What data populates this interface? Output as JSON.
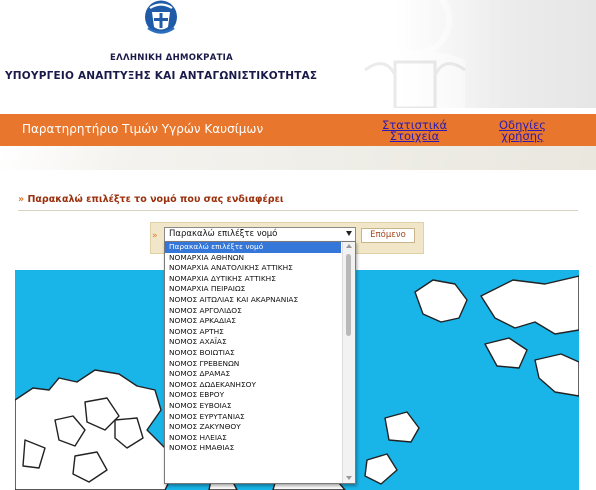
{
  "header": {
    "government": "ΕΛΛΗΝΙΚΗ ΔΗΜΟΚΡΑΤΙΑ",
    "ministry": "ΥΠΟΥΡΓΕΙΟ ΑΝΑΠΤΥΞΗΣ ΚΑΙ ΑΝΤΑΓΩΝΙΣΤΙΚΟΤΗΤΑΣ",
    "emblem_icon": "hellenic-republic-emblem"
  },
  "nav": {
    "main_title": "Παρατηρητήριο Τιμών Υγρών Καυσίμων",
    "statistics_line1": "Στατιστικά",
    "statistics_line2": "Στοιχεία",
    "help_line1": "Οδηγίες",
    "help_line2": "χρήσης"
  },
  "prompt": {
    "bullet": "»",
    "text": "Παρακαλώ επιλέξτε το νομό που σας ενδιαφέρει"
  },
  "selector": {
    "bullet": "»",
    "selected_value": "Παρακαλώ επιλέξτε νομό",
    "next_button": "Επόμενο",
    "options": [
      "Παρακαλώ επιλέξτε νομό",
      "ΝΟΜΑΡΧΙΑ ΑΘΗΝΩΝ",
      "ΝΟΜΑΡΧΙΑ ΑΝΑΤΟΛΙΚΗΣ ΑΤΤΙΚΗΣ",
      "ΝΟΜΑΡΧΙΑ ΔΥΤΙΚΗΣ ΑΤΤΙΚΗΣ",
      "ΝΟΜΑΡΧΙΑ ΠΕΙΡΑΙΩΣ",
      "ΝΟΜΟΣ ΑΙΤΩΛΙΑΣ ΚΑΙ ΑΚΑΡΝΑΝΙΑΣ",
      "ΝΟΜΟΣ ΑΡΓΟΛΙΔΟΣ",
      "ΝΟΜΟΣ ΑΡΚΑΔΙΑΣ",
      "ΝΟΜΟΣ ΑΡΤΗΣ",
      "ΝΟΜΟΣ ΑΧΑΪΑΣ",
      "ΝΟΜΟΣ ΒΟΙΩΤΙΑΣ",
      "ΝΟΜΟΣ ΓΡΕΒΕΝΩΝ",
      "ΝΟΜΟΣ ΔΡΑΜΑΣ",
      "ΝΟΜΟΣ ΔΩΔΕΚΑΝΗΣΟΥ",
      "ΝΟΜΟΣ ΕΒΡΟΥ",
      "ΝΟΜΟΣ ΕΥΒΟΙΑΣ",
      "ΝΟΜΟΣ ΕΥΡΥΤΑΝΙΑΣ",
      "ΝΟΜΟΣ ΖΑΚΥΝΘΟΥ",
      "ΝΟΜΟΣ ΗΛΕΙΑΣ",
      "ΝΟΜΟΣ ΗΜΑΘΙΑΣ"
    ]
  },
  "map": {
    "icon": "greece-map",
    "sea_color": "#19b4e8",
    "land_color": "#ffffff"
  },
  "colors": {
    "navbar": "#e8762c",
    "link": "#2c1bb0",
    "prompt": "#9a2f0c",
    "panel": "#f1e6c8",
    "selected_option": "#3477d9"
  }
}
